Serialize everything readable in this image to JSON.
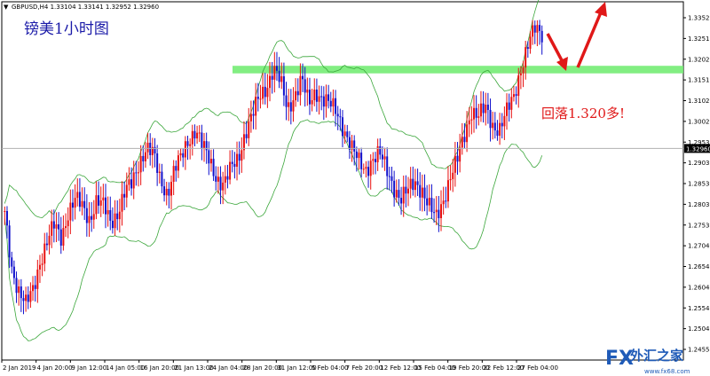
{
  "chart_data": {
    "type": "candlestick",
    "symbol_header": "GBPUSD,H4  1.33104 1.33141 1.32952 1.32960",
    "title": "镑美1小时图",
    "annotation": "回落1.320多!",
    "current_price": 1.2996,
    "current_price_label": "1.32960",
    "y_ticks": [
      "1.33520",
      "1.32515",
      "1.32020",
      "1.31515",
      "1.31020",
      "1.30025",
      "1.29530",
      "1.29035",
      "1.28530",
      "1.28030",
      "1.27535",
      "1.27040",
      "1.26545",
      "1.26040",
      "1.25540",
      "1.25040",
      "1.24550"
    ],
    "x_ticks": [
      "2 Jan 2019",
      "4 Jan 20:00",
      "9 Jan 12:00",
      "14 Jan 05:00",
      "16 Jan 20:00",
      "21 Jan 13:00",
      "24 Jan 04:00",
      "28 Jan 20:00",
      "31 Jan 12:00",
      "5 Feb 04:00",
      "7 Feb 20:00",
      "12 Feb 12:00",
      "15 Feb 04:00",
      "19 Feb 20:00",
      "22 Feb 12:00",
      "27 Feb 04:00"
    ],
    "support_zone": [
      1.3195,
      1.3215
    ],
    "price_path": [
      1.282,
      1.268,
      1.262,
      1.258,
      1.262,
      1.27,
      1.275,
      1.279,
      1.276,
      1.283,
      1.286,
      1.284,
      1.281,
      1.286,
      1.284,
      1.28,
      1.283,
      1.288,
      1.29,
      1.296,
      1.3,
      1.298,
      1.291,
      1.288,
      1.294,
      1.297,
      1.302,
      1.305,
      1.3,
      1.296,
      1.292,
      1.29,
      1.294,
      1.297,
      1.304,
      1.308,
      1.313,
      1.316,
      1.321,
      1.317,
      1.31,
      1.314,
      1.318,
      1.311,
      1.315,
      1.313,
      1.311,
      1.309,
      1.305,
      1.3,
      1.296,
      1.294,
      1.297,
      1.298,
      1.294,
      1.29,
      1.286,
      1.288,
      1.291,
      1.289,
      1.284,
      1.281,
      1.286,
      1.292,
      1.296,
      1.303,
      1.31,
      1.308,
      1.31,
      1.306,
      1.305,
      1.309,
      1.313,
      1.321,
      1.327,
      1.331,
      1.33
    ],
    "price_min": 1.244,
    "price_max": 1.338,
    "colors": {
      "bull": "#e81010",
      "bear": "#1010cc",
      "band": "#3aa63a",
      "zone": "#74ec74",
      "arrow": "#e01818",
      "title": "#1a1aa8"
    },
    "watermark": {
      "brand": "FX",
      "name": "外汇之家",
      "url": "www.fx68.com"
    },
    "grid": false
  }
}
